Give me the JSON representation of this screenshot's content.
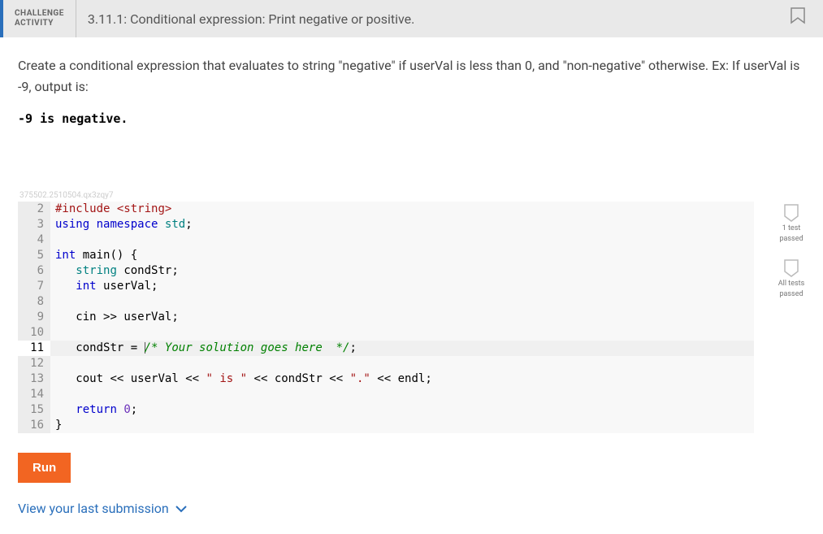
{
  "header": {
    "badge_line1": "CHALLENGE",
    "badge_line2": "ACTIVITY",
    "title": "3.11.1: Conditional expression: Print negative or positive."
  },
  "description": "Create a conditional expression that evaluates to string \"negative\" if userVal is less than 0, and \"non-negative\" otherwise. Ex: If userVal is -9, output is:",
  "example_output": "-9 is negative.",
  "watermark": "375502.2510504.qx3zqy7",
  "code": {
    "lines": [
      {
        "n": "2",
        "tokens": [
          {
            "c": "tok-pp",
            "t": "#include"
          },
          {
            "c": "",
            "t": " "
          },
          {
            "c": "tok-str",
            "t": "<string>"
          }
        ]
      },
      {
        "n": "3",
        "tokens": [
          {
            "c": "tok-kw",
            "t": "using"
          },
          {
            "c": "",
            "t": " "
          },
          {
            "c": "tok-kw",
            "t": "namespace"
          },
          {
            "c": "",
            "t": " "
          },
          {
            "c": "tok-ns",
            "t": "std"
          },
          {
            "c": "tok-punc",
            "t": ";"
          }
        ]
      },
      {
        "n": "4",
        "tokens": [
          {
            "c": "",
            "t": ""
          }
        ]
      },
      {
        "n": "5",
        "tokens": [
          {
            "c": "tok-kw",
            "t": "int"
          },
          {
            "c": "",
            "t": " "
          },
          {
            "c": "tok-func",
            "t": "main"
          },
          {
            "c": "tok-punc",
            "t": "()"
          },
          {
            "c": "",
            "t": " "
          },
          {
            "c": "tok-punc",
            "t": "{"
          }
        ]
      },
      {
        "n": "6",
        "tokens": [
          {
            "c": "",
            "t": "   "
          },
          {
            "c": "tok-type",
            "t": "string"
          },
          {
            "c": "",
            "t": " "
          },
          {
            "c": "tok-var",
            "t": "condStr"
          },
          {
            "c": "tok-punc",
            "t": ";"
          }
        ]
      },
      {
        "n": "7",
        "tokens": [
          {
            "c": "",
            "t": "   "
          },
          {
            "c": "tok-kw",
            "t": "int"
          },
          {
            "c": "",
            "t": " "
          },
          {
            "c": "tok-var",
            "t": "userVal"
          },
          {
            "c": "tok-punc",
            "t": ";"
          }
        ]
      },
      {
        "n": "8",
        "tokens": [
          {
            "c": "",
            "t": ""
          }
        ]
      },
      {
        "n": "9",
        "tokens": [
          {
            "c": "",
            "t": "   "
          },
          {
            "c": "tok-var",
            "t": "cin"
          },
          {
            "c": "",
            "t": " "
          },
          {
            "c": "tok-op",
            "t": ">>"
          },
          {
            "c": "",
            "t": " "
          },
          {
            "c": "tok-var",
            "t": "userVal"
          },
          {
            "c": "tok-punc",
            "t": ";"
          }
        ]
      },
      {
        "n": "10",
        "tokens": [
          {
            "c": "",
            "t": ""
          }
        ]
      },
      {
        "n": "11",
        "active": true,
        "cursor_before_comment": true,
        "tokens": [
          {
            "c": "",
            "t": "   "
          },
          {
            "c": "tok-var",
            "t": "condStr"
          },
          {
            "c": "",
            "t": " "
          },
          {
            "c": "tok-op",
            "t": "="
          },
          {
            "c": "",
            "t": " "
          },
          {
            "c": "tok-comment",
            "t": "/* Your solution goes here  */"
          },
          {
            "c": "tok-punc",
            "t": ";"
          }
        ]
      },
      {
        "n": "12",
        "tokens": [
          {
            "c": "",
            "t": ""
          }
        ]
      },
      {
        "n": "13",
        "tokens": [
          {
            "c": "",
            "t": "   "
          },
          {
            "c": "tok-var",
            "t": "cout"
          },
          {
            "c": "",
            "t": " "
          },
          {
            "c": "tok-op",
            "t": "<<"
          },
          {
            "c": "",
            "t": " "
          },
          {
            "c": "tok-var",
            "t": "userVal"
          },
          {
            "c": "",
            "t": " "
          },
          {
            "c": "tok-op",
            "t": "<<"
          },
          {
            "c": "",
            "t": " "
          },
          {
            "c": "tok-str",
            "t": "\" is \""
          },
          {
            "c": "",
            "t": " "
          },
          {
            "c": "tok-op",
            "t": "<<"
          },
          {
            "c": "",
            "t": " "
          },
          {
            "c": "tok-var",
            "t": "condStr"
          },
          {
            "c": "",
            "t": " "
          },
          {
            "c": "tok-op",
            "t": "<<"
          },
          {
            "c": "",
            "t": " "
          },
          {
            "c": "tok-str",
            "t": "\".\""
          },
          {
            "c": "",
            "t": " "
          },
          {
            "c": "tok-op",
            "t": "<<"
          },
          {
            "c": "",
            "t": " "
          },
          {
            "c": "tok-var",
            "t": "endl"
          },
          {
            "c": "tok-punc",
            "t": ";"
          }
        ]
      },
      {
        "n": "14",
        "tokens": [
          {
            "c": "",
            "t": ""
          }
        ]
      },
      {
        "n": "15",
        "tokens": [
          {
            "c": "",
            "t": "   "
          },
          {
            "c": "tok-kw",
            "t": "return"
          },
          {
            "c": "",
            "t": " "
          },
          {
            "c": "tok-num",
            "t": "0"
          },
          {
            "c": "tok-punc",
            "t": ";"
          }
        ]
      },
      {
        "n": "16",
        "tokens": [
          {
            "c": "tok-punc",
            "t": "}"
          }
        ]
      }
    ]
  },
  "tests": [
    {
      "label_line1": "1 test",
      "label_line2": "passed"
    },
    {
      "label_line1": "All tests",
      "label_line2": "passed"
    }
  ],
  "run_button": "Run",
  "view_submission": "View your last submission"
}
